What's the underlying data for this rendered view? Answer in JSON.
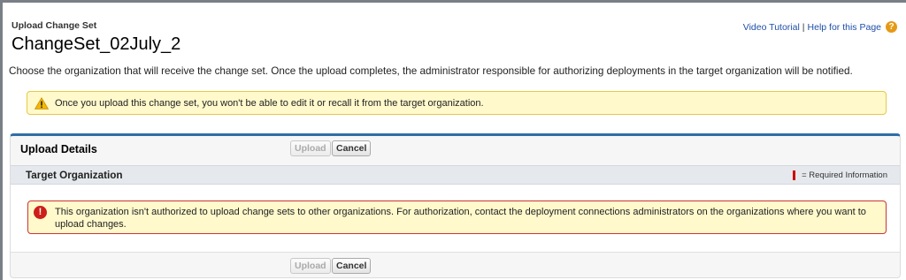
{
  "header": {
    "subtitle": "Upload Change Set",
    "title": "ChangeSet_02July_2"
  },
  "help": {
    "video_tutorial": "Video Tutorial",
    "separator": "|",
    "help_for_page": "Help for this Page",
    "help_icon": "?"
  },
  "intro_text": "Choose the organization that will receive the change set. Once the upload completes, the administrator responsible for authorizing deployments in the target organization will be notified.",
  "warning": {
    "icon": "warning-triangle-icon",
    "text": "Once you upload this change set, you won't be able to edit it or recall it from the target organization."
  },
  "panel": {
    "title": "Upload Details",
    "upload_label": "Upload",
    "cancel_label": "Cancel",
    "section": {
      "title": "Target Organization",
      "required_legend": "= Required Information"
    },
    "error": {
      "icon": "!",
      "text": "This organization isn't authorized to upload change sets to other organizations. For authorization, contact the deployment connections administrators on the organizations where you want to upload changes."
    }
  },
  "colors": {
    "accent": "#2f6ea8",
    "link": "#1f4fa8",
    "warning_bg": "#fff9cc",
    "error_border": "#cc3333",
    "required": "#cc0000"
  }
}
